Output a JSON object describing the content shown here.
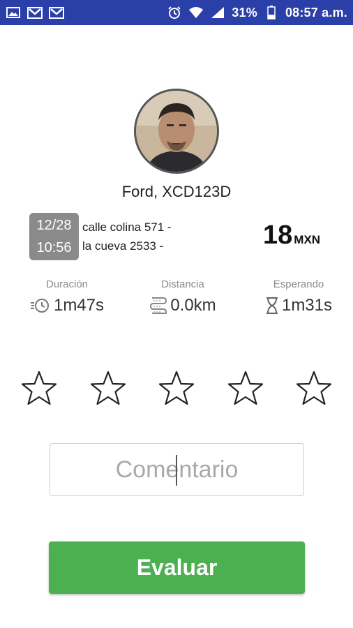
{
  "status_bar": {
    "battery": "31%",
    "time": "08:57 a.m.",
    "background": "#2b3fa8"
  },
  "trip": {
    "vehicle": "Ford, XCD123D",
    "date": "12/28",
    "time": "10:56",
    "origin": "calle colina 571  -",
    "destination": "la cueva 2533  -",
    "price": "18",
    "currency": "MXN"
  },
  "stats": {
    "duration": {
      "label": "Duración",
      "value": "1m47s"
    },
    "distance": {
      "label": "Distancia",
      "value": "0.0km"
    },
    "waiting": {
      "label": "Esperando",
      "value": "1m31s"
    }
  },
  "rating": {
    "stars_total": 5,
    "stars_selected": 0
  },
  "comment": {
    "placeholder": "Comentario",
    "value": ""
  },
  "submit": {
    "label": "Evaluar",
    "color": "#4caf50"
  }
}
